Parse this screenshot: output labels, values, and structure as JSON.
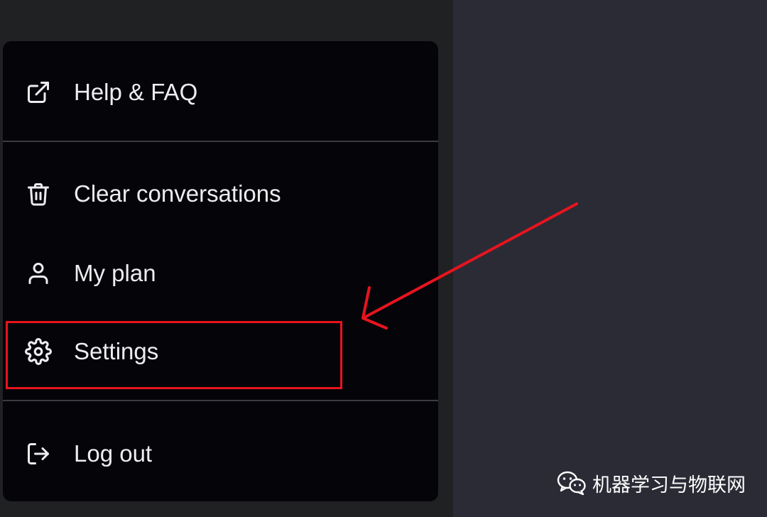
{
  "menu": {
    "items": [
      {
        "label": "Help & FAQ",
        "icon": "external-link-icon"
      },
      {
        "label": "Clear conversations",
        "icon": "trash-icon"
      },
      {
        "label": "My plan",
        "icon": "user-icon"
      },
      {
        "label": "Settings",
        "icon": "gear-icon"
      },
      {
        "label": "Log out",
        "icon": "logout-icon"
      }
    ]
  },
  "annotation": {
    "color": "#e8141e",
    "target": "Settings"
  },
  "watermark": {
    "text": "机器学习与物联网",
    "icon": "wechat-icon"
  },
  "colors": {
    "menu_bg": "#050509",
    "sidebar_bg": "#202123",
    "main_bg": "#2b2b36",
    "text": "#ececf1"
  }
}
